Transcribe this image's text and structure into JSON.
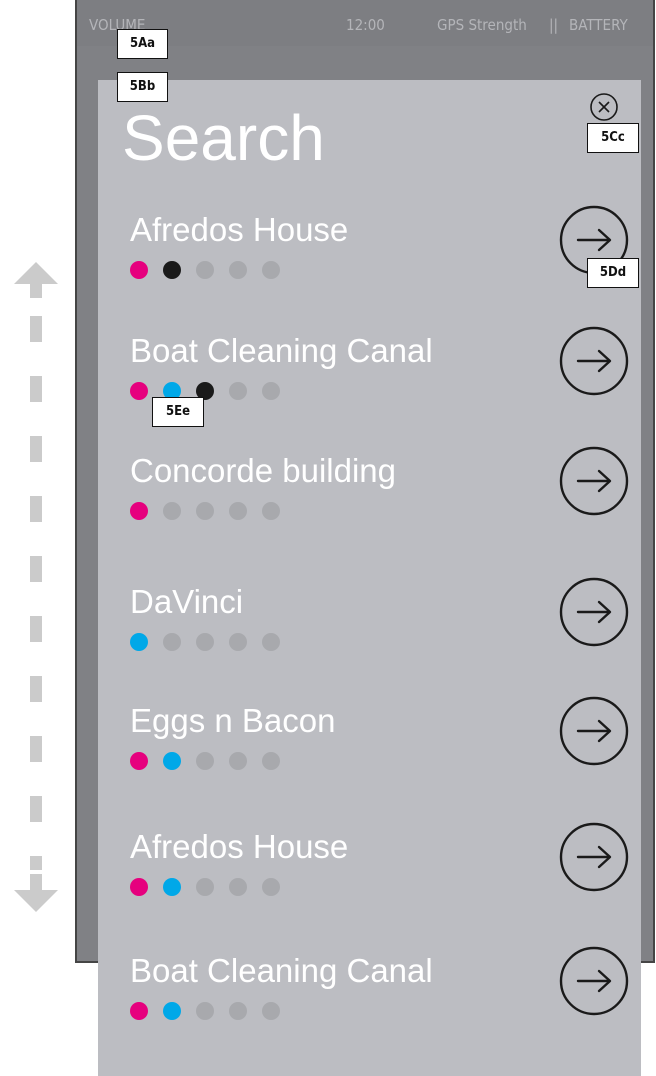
{
  "status_bar": {
    "volume": "VOLUME",
    "time": "12:00",
    "gps": "GPS Strength",
    "separator": "||",
    "battery": "BATTERY"
  },
  "search": {
    "title": "Search",
    "close_icon": "close-circle-icon",
    "go_icon": "arrow-right-circle-icon"
  },
  "results": [
    {
      "name": "Afredos House",
      "dots": [
        "#e6007e",
        "#1a1a1a",
        "#a8a9ad",
        "#a8a9ad",
        "#a8a9ad"
      ]
    },
    {
      "name": "Boat Cleaning Canal",
      "dots": [
        "#e6007e",
        "#00a8e8",
        "#1a1a1a",
        "#a8a9ad",
        "#a8a9ad"
      ]
    },
    {
      "name": "Concorde building",
      "dots": [
        "#e6007e",
        "#a8a9ad",
        "#a8a9ad",
        "#a8a9ad",
        "#a8a9ad"
      ]
    },
    {
      "name": "DaVinci",
      "dots": [
        "#00a8e8",
        "#a8a9ad",
        "#a8a9ad",
        "#a8a9ad",
        "#a8a9ad"
      ]
    },
    {
      "name": "Eggs n Bacon",
      "dots": [
        "#e6007e",
        "#00a8e8",
        "#a8a9ad",
        "#a8a9ad",
        "#a8a9ad"
      ]
    },
    {
      "name": "Afredos House",
      "dots": [
        "#e6007e",
        "#00a8e8",
        "#a8a9ad",
        "#a8a9ad",
        "#a8a9ad"
      ]
    },
    {
      "name": "Boat Cleaning Canal",
      "dots": [
        "#e6007e",
        "#00a8e8",
        "#a8a9ad",
        "#a8a9ad",
        "#a8a9ad"
      ]
    }
  ],
  "scroll_indicator": "scroll-up-down-arrow-icon",
  "annotations": {
    "a": "5Aa",
    "b": "5Bb",
    "c": "5Cc",
    "d": "5Dd",
    "e": "5Ee"
  },
  "colors": {
    "device_background": "#808185",
    "panel_background": "#bcbdc2",
    "text": "#ffffff",
    "accent_magenta": "#e6007e",
    "accent_cyan": "#00a8e8"
  }
}
